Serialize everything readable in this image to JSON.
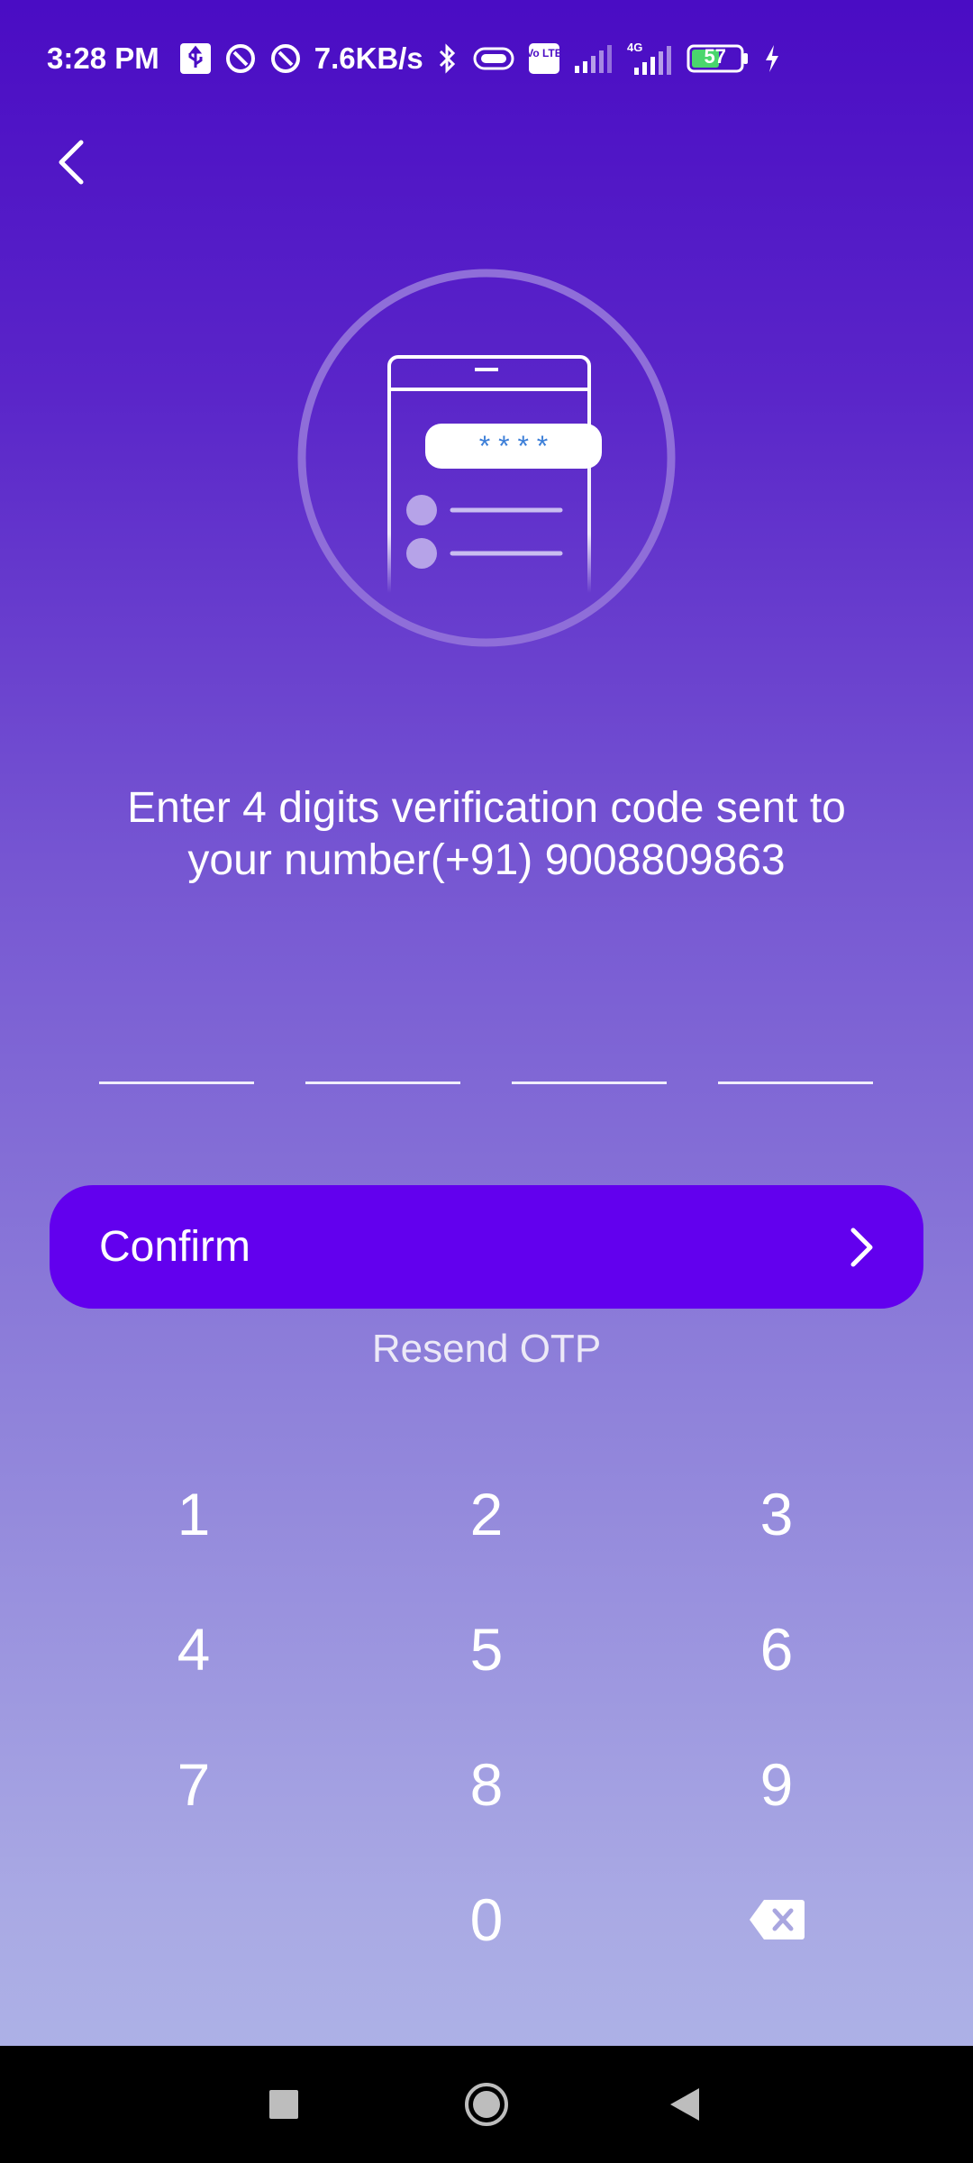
{
  "status_bar": {
    "time": "3:28 PM",
    "network_speed": "7.6KB/s",
    "network_type": "4G",
    "volte_label": "Vo LTE",
    "battery_level": "57",
    "icons": [
      "usb-icon",
      "data-saver-icon",
      "data-saver-icon",
      "bluetooth-icon",
      "vibrate-icon",
      "volte-icon",
      "signal-icon",
      "signal-4g-icon",
      "battery-icon",
      "charging-icon"
    ]
  },
  "header": {
    "back_icon": "chevron-left-icon"
  },
  "illustration": {
    "code_mask": "* * * *"
  },
  "message": {
    "line1": "Enter 4 digits verification code sent to",
    "line2": "your number(+91) 9008809863"
  },
  "otp": {
    "digits": [
      "",
      "",
      "",
      ""
    ]
  },
  "confirm_button": {
    "label": "Confirm",
    "icon": "chevron-right-icon"
  },
  "resend": {
    "label": "Resend OTP"
  },
  "keypad": {
    "keys": [
      "1",
      "2",
      "3",
      "4",
      "5",
      "6",
      "7",
      "8",
      "9",
      "",
      "0",
      "backspace"
    ]
  },
  "nav_bar": {
    "buttons": [
      "recents-square-icon",
      "home-circle-icon",
      "back-triangle-icon"
    ]
  },
  "colors": {
    "accent": "#6200ee",
    "background_top": "#4a0cc4",
    "background_bottom": "#b0b7e8"
  }
}
